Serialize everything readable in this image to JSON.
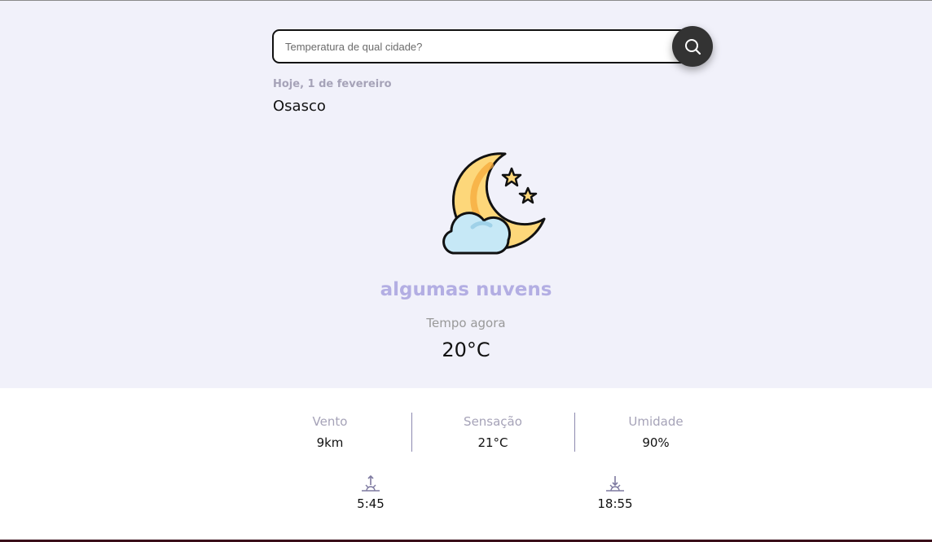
{
  "search": {
    "placeholder": "Temperatura de qual cidade?",
    "icon": "search-icon"
  },
  "location": {
    "date": "Hoje, 1 de fevereiro",
    "city": "Osasco"
  },
  "weather": {
    "icon": "moon-cloud-stars-icon",
    "description": "algumas nuvens",
    "now_label": "Tempo agora",
    "temperature": "20°C"
  },
  "stats": [
    {
      "label": "Vento",
      "value": "9km"
    },
    {
      "label": "Sensação",
      "value": "21°C"
    },
    {
      "label": "Umidade",
      "value": "90%"
    }
  ],
  "sun": {
    "sunrise": {
      "icon": "sunrise-icon",
      "time": "5:45"
    },
    "sunset": {
      "icon": "sunset-icon",
      "time": "18:55"
    }
  },
  "colors": {
    "hero_bg": "#f1f1fa",
    "accent": "#b3aee3",
    "muted": "#a6a3b8",
    "button": "#333333"
  }
}
